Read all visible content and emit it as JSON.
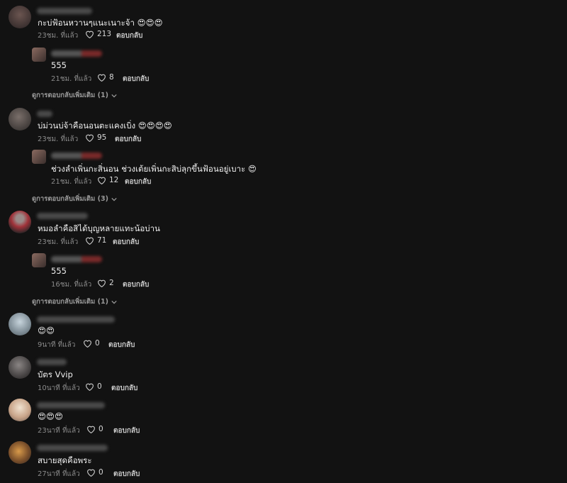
{
  "comments": [
    {
      "text": "กะบ่ฟ้อนหวานๆแนะเนาะจ้า 😍😍😍",
      "time": "23ชม. ที่แล้ว",
      "likes": "213",
      "reply_label": "ตอบกลับ",
      "replies": [
        {
          "text": "555",
          "time": "21ชม. ที่แล้ว",
          "likes": "8",
          "reply_label": "ตอบกลับ"
        }
      ],
      "more_label": "ดูการตอบกลับเพิ่มเติม (1)"
    },
    {
      "text": "บ่ม่วนบ่จ้าคือนอนตะแคงเบิ่ง 😍😍😍😍",
      "time": "23ชม. ที่แล้ว",
      "likes": "95",
      "reply_label": "ตอบกลับ",
      "replies": [
        {
          "text": "ช่วงลำเพิ่นกะสิ่นอน ช่วงเต้ยเพิ่นกะสิบ่ลุกขึ้นฟ้อนอยู่เบาะ 😍",
          "time": "21ชม. ที่แล้ว",
          "likes": "12",
          "reply_label": "ตอบกลับ"
        }
      ],
      "more_label": "ดูการตอบกลับเพิ่มเติม (3)"
    },
    {
      "text": "หมอลำคือสิได้บุญหลายแทะน้อบ่าน",
      "time": "23ชม. ที่แล้ว",
      "likes": "71",
      "reply_label": "ตอบกลับ",
      "replies": [
        {
          "text": "555",
          "time": "16ชม. ที่แล้ว",
          "likes": "2",
          "reply_label": "ตอบกลับ"
        }
      ],
      "more_label": "ดูการตอบกลับเพิ่มเติม (1)"
    },
    {
      "text": "😍😍",
      "time": "9นาที ที่แล้ว",
      "likes": "0",
      "reply_label": "ตอบกลับ"
    },
    {
      "text": "บัตร Vvip",
      "time": "10นาที ที่แล้ว",
      "likes": "0",
      "reply_label": "ตอบกลับ"
    },
    {
      "text": "😍😍😍",
      "time": "23นาที ที่แล้ว",
      "likes": "0",
      "reply_label": "ตอบกลับ"
    },
    {
      "text": "สบายสุดคือพระ",
      "time": "27นาที ที่แล้ว",
      "likes": "0",
      "reply_label": "ตอบกลับ"
    }
  ],
  "icons": {
    "like": "heart-outline-icon",
    "expand": "chevron-down-icon"
  },
  "colors": {
    "background": "#121212",
    "meta": "#8a8a8a"
  }
}
